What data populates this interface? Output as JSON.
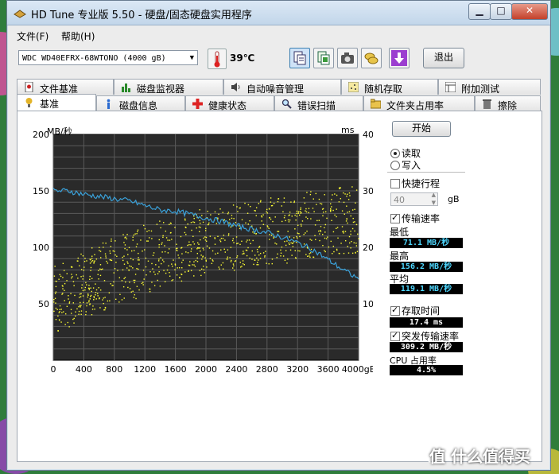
{
  "window": {
    "title": "HD Tune 专业版 5.50 - 硬盘/固态硬盘实用程序",
    "controls": [
      "minimize-icon",
      "maximize-icon",
      "close-icon"
    ]
  },
  "menu": [
    "文件(F)",
    "帮助(H)"
  ],
  "toolbar": {
    "drive": "WDC WD40EFRX-68WTONO (4000 gB)",
    "temperature": "39℃",
    "exit_label": "退出",
    "icons": [
      "copy-text-icon",
      "copy-screenshot-icon",
      "camera-icon",
      "coins-icon",
      "download-icon"
    ]
  },
  "tabs_top": [
    "文件基准",
    "磁盘监视器",
    "自动噪音管理",
    "随机存取",
    "附加测试"
  ],
  "tabs_bottom": [
    "基准",
    "磁盘信息",
    "健康状态",
    "错误扫描",
    "文件夹占用率",
    "擦除"
  ],
  "selected_tab": "基准",
  "controls": {
    "start_label": "开始",
    "read_label": "读取",
    "write_label": "写入",
    "mode": "read",
    "short_stroke_label": "快捷行程",
    "short_stroke_checked": false,
    "short_stroke_value": "40",
    "short_stroke_unit": "gB",
    "transfer_rate_label": "传输速率",
    "transfer_rate_checked": true,
    "min_label": "最低",
    "min_value": "71.1 MB/秒",
    "max_label": "最高",
    "max_value": "156.2 MB/秒",
    "avg_label": "平均",
    "avg_value": "119.1 MB/秒",
    "access_time_label": "存取时间",
    "access_time_checked": true,
    "access_time_value": "17.4 ms",
    "burst_label": "突发传输速率",
    "burst_checked": true,
    "burst_value": "309.2 MB/秒",
    "cpu_label": "CPU 占用率",
    "cpu_value": "4.5%"
  },
  "watermark": "值 什么值得买",
  "chart_data": {
    "type": "line",
    "title": "",
    "xlabel": "gB",
    "ylabel": "MB/秒",
    "y2label": "ms",
    "xlim": [
      0,
      4000
    ],
    "ylim": [
      0,
      200
    ],
    "y2lim": [
      0,
      40
    ],
    "x_ticks": [
      "0",
      "400",
      "800",
      "1200",
      "1600",
      "2000",
      "2400",
      "2800",
      "3200",
      "3600",
      "4000gB"
    ],
    "y_ticks": [
      "200",
      "150",
      "100",
      "50"
    ],
    "y2_ticks": [
      "40",
      "30",
      "20",
      "10"
    ],
    "grid": true,
    "series": [
      {
        "name": "",
        "color": "#3aa0d8",
        "x": [
          0,
          200,
          400,
          600,
          800,
          1000,
          1200,
          1400,
          1600,
          1800,
          2000,
          2200,
          2400,
          2600,
          2800,
          3000,
          3200,
          3400,
          3600,
          3800,
          4000
        ],
        "y": [
          150,
          150,
          147,
          145,
          143,
          141,
          137,
          133,
          132,
          129,
          126,
          123,
          119,
          116,
          113,
          109,
          104,
          98,
          89,
          80,
          72
        ]
      }
    ],
    "access_time_scatter": {
      "color": "#ffff33",
      "units": "ms",
      "x_range": [
        0,
        4000
      ],
      "band_low": [
        5,
        6,
        8,
        9,
        10,
        11,
        12,
        13,
        14,
        15,
        15,
        16,
        16,
        17,
        17,
        17,
        18,
        18,
        19,
        19,
        19
      ],
      "band_high": [
        17,
        18,
        19,
        21,
        22,
        23,
        24,
        25,
        25,
        26,
        27,
        27,
        28,
        28,
        29,
        29,
        29,
        30,
        30,
        31,
        31
      ]
    }
  }
}
